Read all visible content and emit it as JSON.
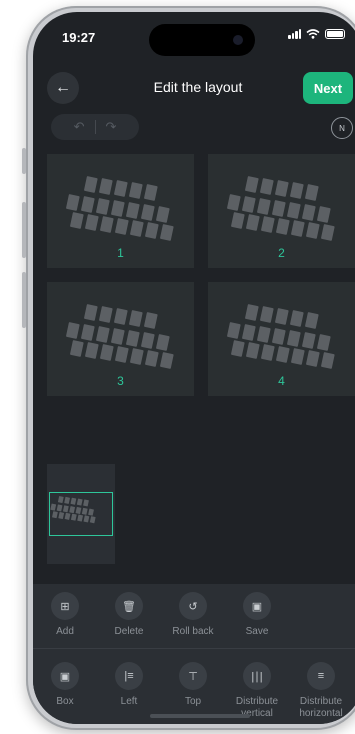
{
  "status": {
    "time": "19:27"
  },
  "header": {
    "back_icon": "arrow-left-icon",
    "title": "Edit the layout",
    "next_label": "Next",
    "accent": "#1db57c"
  },
  "history": {
    "undo_icon": "undo-icon",
    "redo_icon": "redo-icon"
  },
  "compass": {
    "icon": "compass-icon",
    "letter": "N"
  },
  "layouts": [
    {
      "number": "1"
    },
    {
      "number": "2"
    },
    {
      "number": "3"
    },
    {
      "number": "4"
    }
  ],
  "toolbar": {
    "row1": [
      {
        "icon": "add-icon",
        "label": "Add"
      },
      {
        "icon": "trash-icon",
        "label": "Delete"
      },
      {
        "icon": "rollback-icon",
        "label": "Roll back"
      },
      {
        "icon": "save-icon",
        "label": "Save"
      }
    ],
    "row2": [
      {
        "icon": "box-icon",
        "label": "Box"
      },
      {
        "icon": "align-left-icon",
        "label": "Left"
      },
      {
        "icon": "align-top-icon",
        "label": "Top"
      },
      {
        "icon": "distribute-vertical-icon",
        "label": "Distribute vertical"
      },
      {
        "icon": "distribute-horizontal-icon",
        "label": "Distribute horizontal"
      }
    ]
  }
}
